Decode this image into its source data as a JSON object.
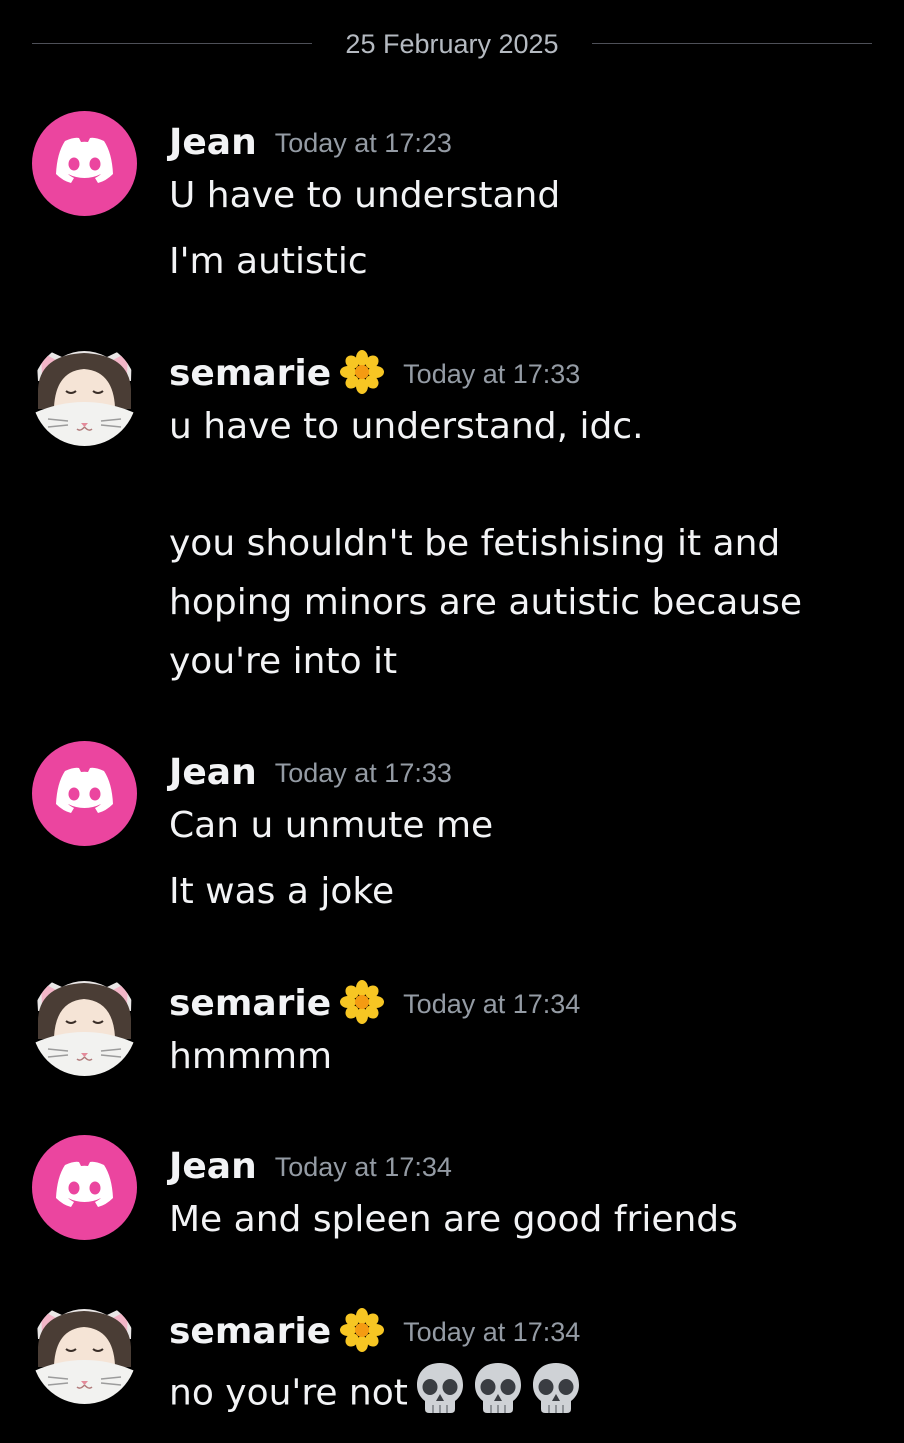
{
  "date_divider": "25 February 2025",
  "messages": [
    {
      "author": "Jean",
      "timestamp": "Today at 17:23",
      "lines": [
        "U have to understand",
        "I'm autistic"
      ]
    },
    {
      "author": "semarie",
      "timestamp": "Today at 17:33",
      "lines": [
        "u have to understand, idc.",
        "you shouldn't be fetishising it and",
        "hoping minors are autistic because",
        "you're into it"
      ]
    },
    {
      "author": "Jean",
      "timestamp": "Today at 17:33",
      "lines": [
        "Can u unmute me",
        "It was a joke"
      ]
    },
    {
      "author": "semarie",
      "timestamp": "Today at 17:34",
      "lines": [
        "hmmmm"
      ]
    },
    {
      "author": "Jean",
      "timestamp": "Today at 17:34",
      "lines": [
        "Me and spleen are good friends"
      ]
    },
    {
      "author": "semarie",
      "timestamp": "Today at 17:34",
      "lines": [
        "no you're not"
      ],
      "emojis": [
        "skull-emoji",
        "skull-emoji",
        "skull-emoji"
      ]
    }
  ],
  "colors": {
    "background": "#000000",
    "discord_avatar": "#eb459f",
    "text": "#f2f3f5",
    "muted": "#949ba4",
    "flower": "#f7c623"
  },
  "icons": {
    "jean_avatar": "discord-logo-icon",
    "semarie_avatar": "cat-girl-avatar",
    "name_badge": "flower-icon"
  }
}
